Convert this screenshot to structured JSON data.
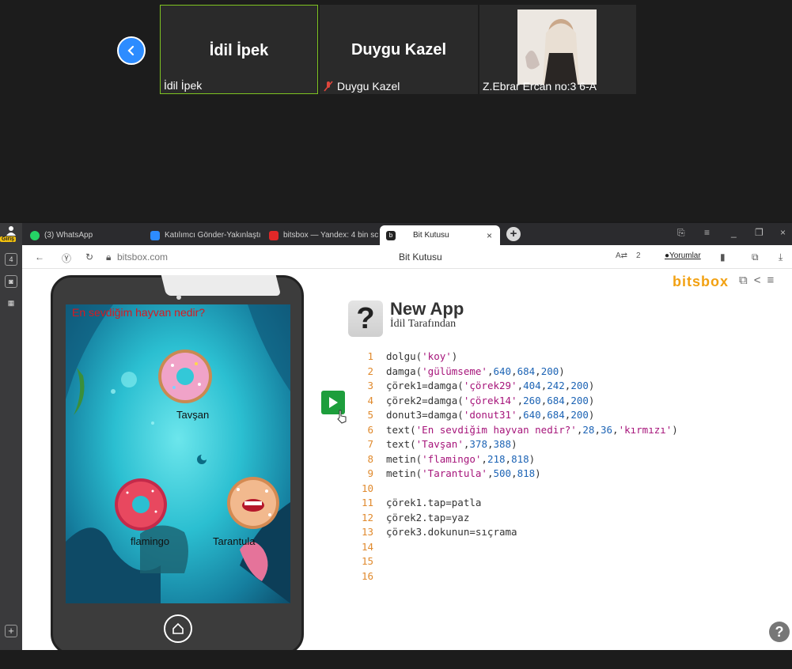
{
  "meeting": {
    "participants": [
      {
        "display_name": "İdil İpek",
        "label": "İdil İpek",
        "muted": false
      },
      {
        "display_name": "Duygu Kazel",
        "label": "Duygu Kazel",
        "muted": true
      },
      {
        "display_name": "",
        "label": "Z.Ebrar Ercan no:3 6-A",
        "muted": false
      }
    ]
  },
  "browser": {
    "sidebar": {
      "login_badge": "Giriş",
      "tab_count": "4"
    },
    "tabs": [
      {
        "label": "(3) WhatsApp",
        "color": "#25d366"
      },
      {
        "label": "Katılımcı Gönder-Yakınlaştı",
        "color": "#2d8cff"
      },
      {
        "label": "bitsbox — Yandex: 4 bin sc",
        "color": "#e02828"
      },
      {
        "label": "Bit Kutusu",
        "color": "#222222",
        "active": true
      }
    ],
    "tab_close": "×",
    "tab_new": "+",
    "address": "bitsbox.com",
    "page_title": "Bit Kutusu",
    "comments_label": "Yorumlar",
    "shield_count": "2"
  },
  "page": {
    "logo": "bitsbox",
    "app": {
      "title": "New App",
      "subtitle": "İdil Tarafından",
      "icon_glyph": "?"
    },
    "tablet_texts": {
      "question": "En sevdiğim hayvan nedir?",
      "tavsan": "Tavşan",
      "flamingo": "flamingo",
      "tarantula": "Tarantula"
    },
    "code_lines": [
      {
        "n": "1",
        "parts": [
          {
            "t": "dolgu("
          },
          {
            "t": "'koy'",
            "c": "s"
          },
          {
            "t": ")"
          }
        ]
      },
      {
        "n": "2",
        "parts": [
          {
            "t": "damga("
          },
          {
            "t": "'gülümseme'",
            "c": "s"
          },
          {
            "t": ","
          },
          {
            "t": "640",
            "c": "n"
          },
          {
            "t": ","
          },
          {
            "t": "684",
            "c": "n"
          },
          {
            "t": ","
          },
          {
            "t": "200",
            "c": "n"
          },
          {
            "t": ")"
          }
        ]
      },
      {
        "n": "3",
        "parts": [
          {
            "t": "çörek1=damga("
          },
          {
            "t": "'çörek29'",
            "c": "s"
          },
          {
            "t": ","
          },
          {
            "t": "404",
            "c": "n"
          },
          {
            "t": ","
          },
          {
            "t": "242",
            "c": "n"
          },
          {
            "t": ","
          },
          {
            "t": "200",
            "c": "n"
          },
          {
            "t": ")"
          }
        ]
      },
      {
        "n": "4",
        "parts": [
          {
            "t": "çörek2=damga("
          },
          {
            "t": "'çörek14'",
            "c": "s"
          },
          {
            "t": ","
          },
          {
            "t": "260",
            "c": "n"
          },
          {
            "t": ","
          },
          {
            "t": "684",
            "c": "n"
          },
          {
            "t": ","
          },
          {
            "t": "200",
            "c": "n"
          },
          {
            "t": ")"
          }
        ]
      },
      {
        "n": "5",
        "parts": [
          {
            "t": "donut3=damga("
          },
          {
            "t": "'donut31'",
            "c": "s"
          },
          {
            "t": ","
          },
          {
            "t": "640",
            "c": "n"
          },
          {
            "t": ","
          },
          {
            "t": "684",
            "c": "n"
          },
          {
            "t": ","
          },
          {
            "t": "200",
            "c": "n"
          },
          {
            "t": ")"
          }
        ]
      },
      {
        "n": "6",
        "parts": [
          {
            "t": "text("
          },
          {
            "t": "'En sevdiğim hayvan nedir?'",
            "c": "s"
          },
          {
            "t": ","
          },
          {
            "t": "28",
            "c": "n"
          },
          {
            "t": ","
          },
          {
            "t": "36",
            "c": "n"
          },
          {
            "t": ","
          },
          {
            "t": "'kırmızı'",
            "c": "s"
          },
          {
            "t": ")"
          }
        ]
      },
      {
        "n": "7",
        "parts": [
          {
            "t": "text("
          },
          {
            "t": "'Tavşan'",
            "c": "s"
          },
          {
            "t": ","
          },
          {
            "t": "378",
            "c": "n"
          },
          {
            "t": ","
          },
          {
            "t": "388",
            "c": "n"
          },
          {
            "t": ")"
          }
        ]
      },
      {
        "n": "8",
        "parts": [
          {
            "t": "metin("
          },
          {
            "t": "'flamingo'",
            "c": "s"
          },
          {
            "t": ","
          },
          {
            "t": "218",
            "c": "n"
          },
          {
            "t": ","
          },
          {
            "t": "818",
            "c": "n"
          },
          {
            "t": ")"
          }
        ]
      },
      {
        "n": "9",
        "parts": [
          {
            "t": "metin("
          },
          {
            "t": "'Tarantula'",
            "c": "s"
          },
          {
            "t": ","
          },
          {
            "t": "500",
            "c": "n"
          },
          {
            "t": ","
          },
          {
            "t": "818",
            "c": "n"
          },
          {
            "t": ")"
          }
        ]
      },
      {
        "n": "10",
        "parts": []
      },
      {
        "n": "11",
        "parts": [
          {
            "t": "çörek1.tap=patla"
          }
        ]
      },
      {
        "n": "12",
        "parts": [
          {
            "t": "çörek2.tap=yaz"
          }
        ]
      },
      {
        "n": "13",
        "parts": [
          {
            "t": "çörek3.dokunun=sıçrama"
          }
        ]
      },
      {
        "n": "14",
        "parts": []
      },
      {
        "n": "15",
        "parts": []
      },
      {
        "n": "16",
        "parts": []
      }
    ],
    "help_glyph": "?"
  },
  "colors": {
    "accent_zoom": "#2d8cff",
    "bitsbox_orange": "#f2a112",
    "run_green": "#1d9e3c",
    "string": "#a6147a",
    "number": "#1d64b5"
  }
}
